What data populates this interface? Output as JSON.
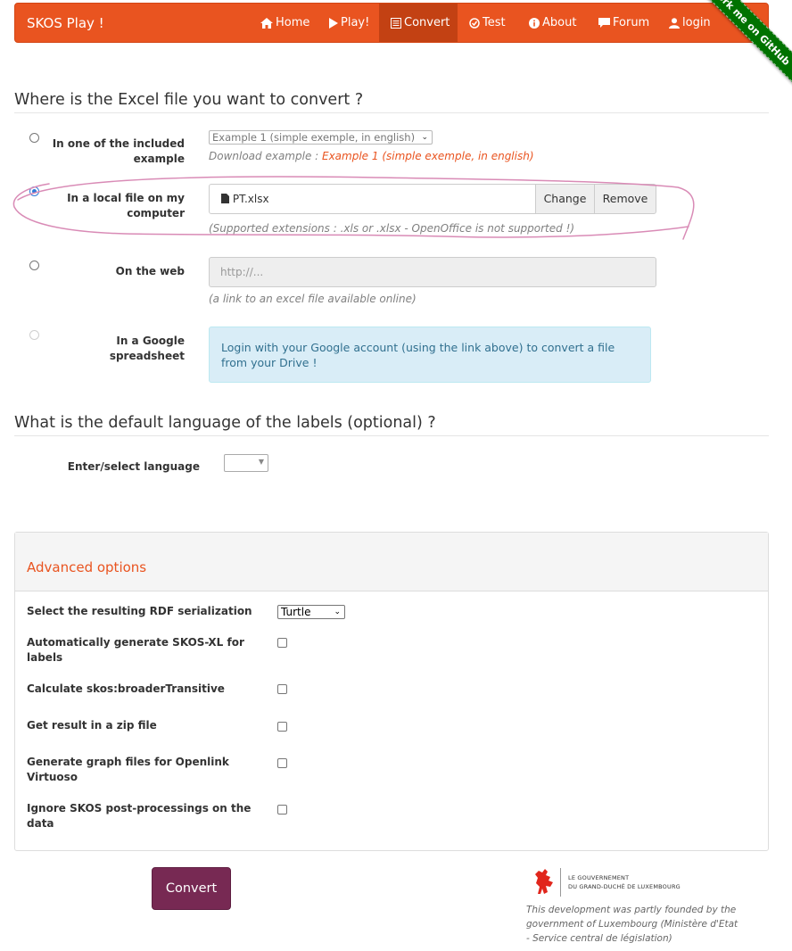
{
  "navbar": {
    "brand": "SKOS Play !",
    "items": [
      {
        "label": "Home",
        "icon": "home-icon"
      },
      {
        "label": "Play!",
        "icon": "play-icon"
      },
      {
        "label": "Convert",
        "icon": "list-icon",
        "active": true
      },
      {
        "label": "Test",
        "icon": "check-circle-icon"
      },
      {
        "label": "About",
        "icon": "info-icon"
      },
      {
        "label": "Forum",
        "icon": "comment-icon"
      },
      {
        "label": "login",
        "icon": "user-icon"
      }
    ],
    "ribbon": "Fork me on GitHub",
    "accent_color": "#e95420"
  },
  "source_section": {
    "title": "Where is the Excel file you want to convert ?",
    "example": {
      "label": "In one of the included example",
      "select_value": "Example 1 (simple exemple, in english)",
      "download_prefix": "Download example : ",
      "download_link": "Example 1 (simple exemple, in english)"
    },
    "local_file": {
      "label": "In a local file on my computer",
      "file_name": "PT.xlsx",
      "change_label": "Change",
      "remove_label": "Remove",
      "help": "(Supported extensions : .xls or .xlsx - OpenOffice is not supported !)",
      "selected": true
    },
    "web": {
      "label": "On the web",
      "placeholder": "http://...",
      "help": "(a link to an excel file available online)"
    },
    "google": {
      "label": "In a Google spreadsheet",
      "info": "Login with your Google account (using the link above) to convert a file from your Drive !"
    }
  },
  "language_section": {
    "title": "What is the default language of the labels (optional) ?",
    "label": "Enter/select language",
    "value": ""
  },
  "advanced": {
    "title": "Advanced options",
    "serialization_label": "Select the resulting RDF serialization",
    "serialization_value": "Turtle",
    "options": [
      {
        "label": "Automatically generate SKOS-XL for labels",
        "checked": false
      },
      {
        "label": "Calculate skos:broaderTransitive",
        "checked": false
      },
      {
        "label": "Get result in a zip file",
        "checked": false
      },
      {
        "label": "Generate graph files for Openlink Virtuoso",
        "checked": false
      },
      {
        "label": "Ignore SKOS post-processings on the data",
        "checked": false
      }
    ]
  },
  "convert_button": "Convert",
  "footer": {
    "gov_line1": "LE GOUVERNEMENT",
    "gov_line2": "DU GRAND-DUCHÉ DE LUXEMBOURG",
    "text": "This development was partly founded by the government of Luxembourg (Ministère d'Etat - Service central de législation)"
  }
}
